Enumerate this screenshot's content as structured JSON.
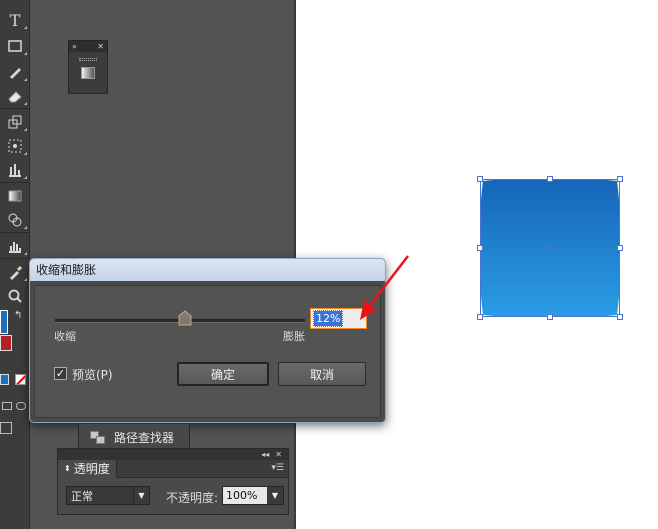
{
  "dialog": {
    "title": "收缩和膨胀",
    "label_left": "收缩",
    "label_right": "膨胀",
    "value": "12%",
    "preview_label": "预览(P)",
    "preview_checked": "✓",
    "ok_label": "确定",
    "cancel_label": "取消"
  },
  "pathfinder": {
    "label": "路径查找器"
  },
  "transparency": {
    "tab_label": "透明度",
    "blend_mode": "正常",
    "opacity_label": "不透明度:",
    "opacity_value": "100%"
  },
  "colors": {
    "accent_blue": "#1e6fc2",
    "shape_gradient_top": "#1565b8",
    "shape_gradient_bottom": "#2b9de6",
    "arrow_red": "#e8141a",
    "value_border": "#f08a24"
  },
  "icons": {
    "toolbar": [
      "type-icon",
      "rectangle-icon",
      "pencil-icon",
      "eraser-icon",
      "scale-icon",
      "free-transform-icon",
      "graph-icon",
      "gradient-icon",
      "shape-builder-icon",
      "column-graph-icon",
      "eyedropper-icon",
      "zoom-icon"
    ]
  }
}
